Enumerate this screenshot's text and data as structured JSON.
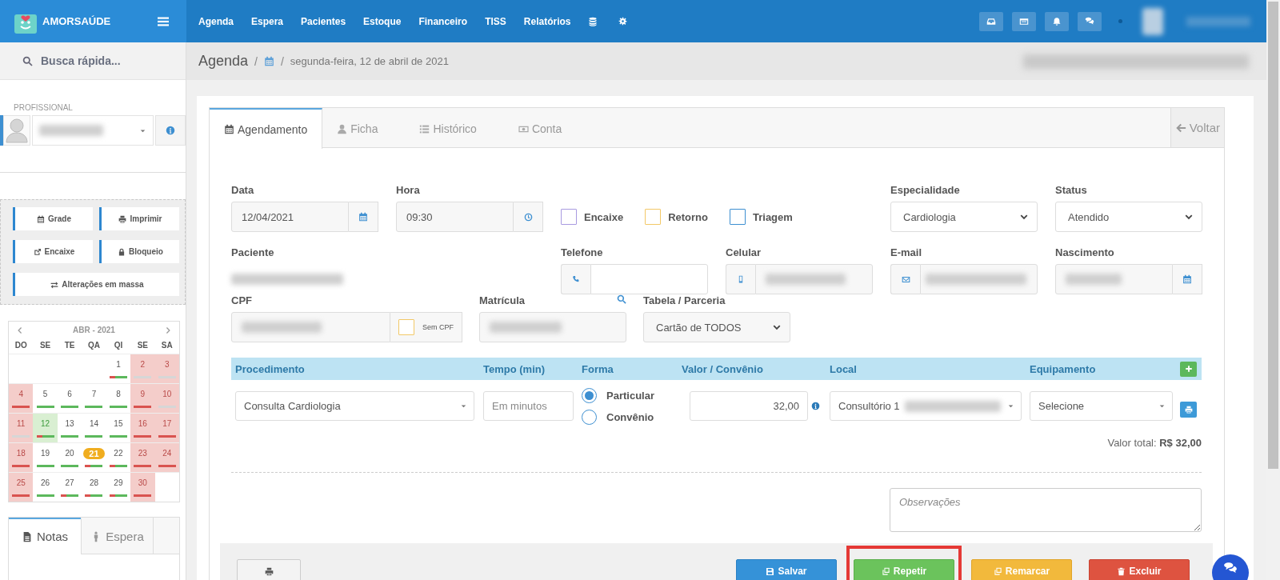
{
  "header": {
    "brand": "AMORSAÚDE",
    "nav": [
      "Agenda",
      "Espera",
      "Pacientes",
      "Estoque",
      "Financeiro",
      "TISS",
      "Relatórios"
    ]
  },
  "breadcrumb": {
    "title": "Agenda",
    "separators": [
      "/",
      "/"
    ],
    "date": "segunda-feira, 12 de abril de 2021"
  },
  "sidebar": {
    "search_placeholder": "Busca rápida...",
    "professional_label": "PROFISSIONAL",
    "actions": [
      "Grade",
      "Imprimir",
      "Encaixe",
      "Bloqueio",
      "Alterações em massa"
    ],
    "calendar": {
      "month": "ABR - 2021",
      "weekdays": [
        "DO",
        "SE",
        "TE",
        "QA",
        "QI",
        "SE",
        "SA"
      ],
      "weeks": [
        [
          {
            "kind": "blank"
          },
          {
            "kind": "blank"
          },
          {
            "kind": "blank"
          },
          {
            "kind": "blank"
          },
          {
            "day": "1",
            "kind": "open",
            "bar": {
              "kind": "partial"
            }
          },
          {
            "day": "2",
            "kind": "closed",
            "bar": {
              "kind": "none"
            }
          },
          {
            "day": "3",
            "kind": "closed",
            "bar": {
              "kind": "none"
            }
          }
        ],
        [
          {
            "day": "4",
            "kind": "closed",
            "bar": {
              "kind": "busy"
            }
          },
          {
            "day": "5",
            "kind": "open",
            "bar": {
              "kind": "free"
            }
          },
          {
            "day": "6",
            "kind": "open",
            "bar": {
              "kind": "free"
            }
          },
          {
            "day": "7",
            "kind": "open",
            "bar": {
              "kind": "free"
            }
          },
          {
            "day": "8",
            "kind": "open",
            "bar": {
              "kind": "free"
            }
          },
          {
            "day": "9",
            "kind": "closed",
            "bar": {
              "kind": "busy"
            }
          },
          {
            "day": "10",
            "kind": "closed",
            "bar": {
              "kind": "none"
            }
          }
        ],
        [
          {
            "day": "11",
            "kind": "closed",
            "bar": {
              "kind": "none"
            }
          },
          {
            "day": "12",
            "kind": "selected",
            "bar": {
              "kind": "partial"
            }
          },
          {
            "day": "13",
            "kind": "open",
            "bar": {
              "kind": "free"
            }
          },
          {
            "day": "14",
            "kind": "open",
            "bar": {
              "kind": "free"
            }
          },
          {
            "day": "15",
            "kind": "open",
            "bar": {
              "kind": "free"
            }
          },
          {
            "day": "16",
            "kind": "closed",
            "bar": {
              "kind": "busy"
            }
          },
          {
            "day": "17",
            "kind": "closed",
            "bar": {
              "kind": "busy"
            }
          }
        ],
        [
          {
            "day": "18",
            "kind": "closed",
            "bar": {
              "kind": "busy"
            }
          },
          {
            "day": "19",
            "kind": "open",
            "bar": {
              "kind": "free"
            }
          },
          {
            "day": "20",
            "kind": "open",
            "bar": {
              "kind": "free"
            }
          },
          {
            "day": "21",
            "kind": "today",
            "bar": {
              "kind": "partial"
            }
          },
          {
            "day": "22",
            "kind": "open",
            "bar": {
              "kind": "partial"
            }
          },
          {
            "day": "23",
            "kind": "closed",
            "bar": {
              "kind": "busy"
            }
          },
          {
            "day": "24",
            "kind": "closed",
            "bar": {
              "kind": "busy"
            }
          }
        ],
        [
          {
            "day": "25",
            "kind": "closed",
            "bar": {
              "kind": "busy"
            }
          },
          {
            "day": "26",
            "kind": "open",
            "bar": {
              "kind": "free"
            }
          },
          {
            "day": "27",
            "kind": "open",
            "bar": {
              "kind": "partial"
            }
          },
          {
            "day": "28",
            "kind": "open",
            "bar": {
              "kind": "partial"
            }
          },
          {
            "day": "29",
            "kind": "open",
            "bar": {
              "kind": "partial"
            }
          },
          {
            "day": "30",
            "kind": "closed",
            "bar": {
              "kind": "busy"
            }
          },
          {
            "kind": "blank"
          }
        ]
      ]
    },
    "tabs": [
      {
        "label": "Notas",
        "selected": true
      },
      {
        "label": "Espera",
        "selected": false
      }
    ]
  },
  "form": {
    "tabs": [
      {
        "label": "Agendamento",
        "selected": true
      },
      {
        "label": "Ficha",
        "selected": false
      },
      {
        "label": "Histórico",
        "selected": false
      },
      {
        "label": "Conta",
        "selected": false
      }
    ],
    "back": "Voltar",
    "data": {
      "label": "Data",
      "value": "12/04/2021"
    },
    "hora": {
      "label": "Hora",
      "value": "09:30"
    },
    "flags": [
      {
        "label": "Encaixe",
        "checked": false,
        "color": "#a99be0"
      },
      {
        "label": "Retorno",
        "checked": false,
        "color": "#f2c867"
      },
      {
        "label": "Triagem",
        "checked": false,
        "color": "#3d8fd1"
      }
    ],
    "especialidade": {
      "label": "Especialidade",
      "value": "Cardiologia"
    },
    "status": {
      "label": "Status",
      "value": "Atendido"
    },
    "paciente": {
      "label": "Paciente"
    },
    "telefone": {
      "label": "Telefone"
    },
    "celular": {
      "label": "Celular"
    },
    "email": {
      "label": "E-mail"
    },
    "nascimento": {
      "label": "Nascimento"
    },
    "cpf": {
      "label": "CPF",
      "sem_cpf": {
        "label": "Sem CPF",
        "checked": false
      }
    },
    "matricula": {
      "label": "Matrícula"
    },
    "tabela": {
      "label": "Tabela / Parceria",
      "value": "Cartão de TODOS"
    },
    "procedures": {
      "columns": [
        "Procedimento",
        "Tempo (min)",
        "Forma",
        "Valor / Convênio",
        "Local",
        "Equipamento"
      ],
      "rows": [
        {
          "procedimento": "Consulta Cardiologia",
          "tempo_placeholder": "Em minutos",
          "forma": [
            {
              "label": "Particular",
              "selected": true
            },
            {
              "label": "Convênio",
              "selected": false
            }
          ],
          "valor": "32,00",
          "local": "Consultório 1",
          "equipamento": "Selecione"
        }
      ],
      "total": "Valor total: **R$ 32,00**"
    },
    "observacoes_placeholder": "Observações",
    "footer": [
      {
        "kind": "print",
        "highlighted": false
      },
      {
        "kind": "save",
        "label": "Salvar",
        "highlighted": false
      },
      {
        "kind": "repeat",
        "label": "Repetir",
        "highlighted": true
      },
      {
        "kind": "reschedule",
        "label": "Remarcar",
        "highlighted": false
      },
      {
        "kind": "delete",
        "label": "Excluir",
        "highlighted": false
      }
    ]
  }
}
